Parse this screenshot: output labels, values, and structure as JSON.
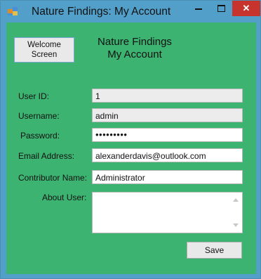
{
  "window": {
    "title": "Nature Findings: My Account",
    "close_glyph": "✕",
    "colors": {
      "frame": "#52a0c9",
      "client": "#3cb371",
      "close": "#c7342d"
    }
  },
  "form": {
    "welcome_button": {
      "line1": "Welcome",
      "line2": "Screen"
    },
    "heading": {
      "line1": "Nature Findings",
      "line2": "My Account"
    },
    "user_id": {
      "label": "User ID:",
      "value": "1"
    },
    "username": {
      "label": "Username:",
      "value": "admin"
    },
    "password": {
      "label": "Password:",
      "value": "•••••••••"
    },
    "email": {
      "label": "Email Address:",
      "value": "alexanderdavis@outlook.com"
    },
    "contributor": {
      "label": "Contributor Name:",
      "value": "Administrator"
    },
    "about": {
      "label": "About User:",
      "value": ""
    },
    "save_label": "Save"
  }
}
